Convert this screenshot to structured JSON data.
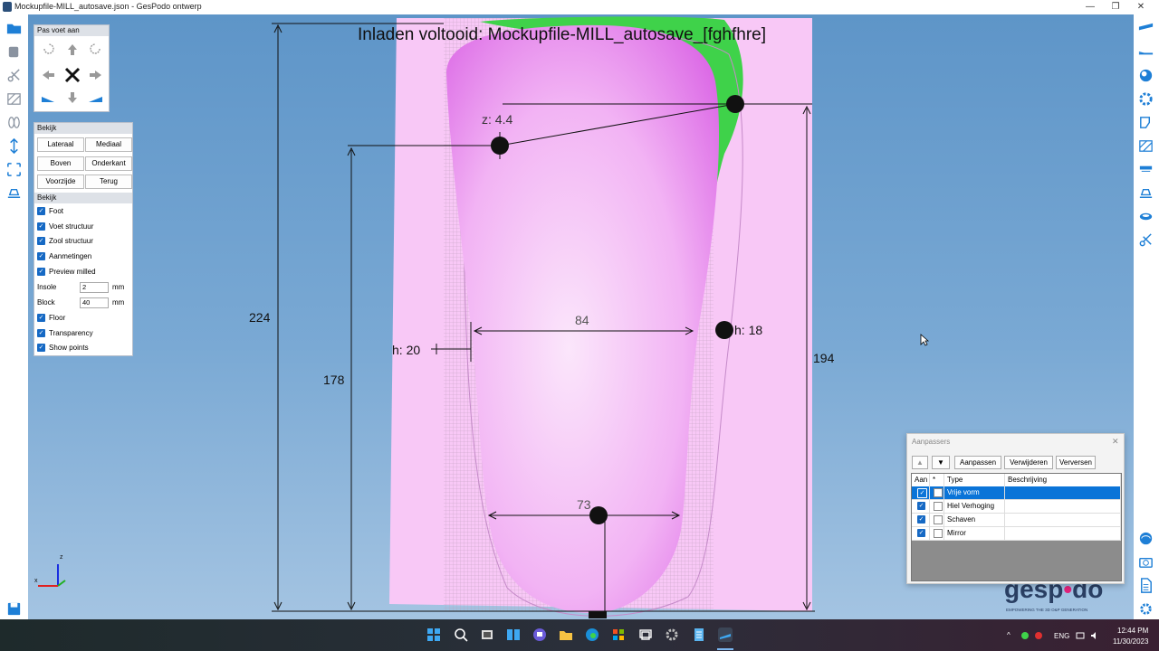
{
  "window": {
    "title": "Mockupfile-MILL_autosave.json - GesPodo ontwerp"
  },
  "pas_voet_aan": {
    "title": "Pas voet aan"
  },
  "bekijk_view": {
    "title": "Bekijk",
    "buttons": [
      "Lateraal",
      "Mediaal",
      "Boven",
      "Onderkant",
      "Voorzijde",
      "Terug"
    ]
  },
  "bekijk_options": {
    "title": "Bekijk",
    "checks_top": [
      "Foot",
      "Voet structuur",
      "Zool structuur",
      "Aanmetingen",
      "Preview milled"
    ],
    "insole_label": "Insole",
    "insole_value": "2",
    "insole_unit": "mm",
    "block_label": "Block",
    "block_value": "40",
    "block_unit": "mm",
    "checks_bottom": [
      "Floor",
      "Transparency",
      "Show points"
    ]
  },
  "viewport": {
    "status": "Inladen voltooid: Mockupfile-MILL_autosave_[fghfhre]",
    "measures": {
      "m224": "224",
      "m178": "178",
      "m194": "194",
      "m84": "84",
      "m73": "73",
      "z": "z: 4.4",
      "h20": "h: 20",
      "h18": "h: 18"
    },
    "axis": {
      "z": "z",
      "x": "x"
    },
    "logo": {
      "text": "gesp",
      "text2": "do",
      "tagline": "EMPOWERING THE 3D O&P GENERATION"
    }
  },
  "aanpassers": {
    "title": "Aanpassers",
    "buttons": {
      "aanpassen": "Aanpassen",
      "verwijderen": "Verwijderen",
      "verversen": "Verversen"
    },
    "columns": {
      "aan": "Aan",
      "star": "*",
      "type": "Type",
      "beschrijving": "Beschrijving"
    },
    "rows": [
      {
        "type": "Vrije vorm",
        "aan": true,
        "star": false,
        "selected": true
      },
      {
        "type": "Hiel Verhoging",
        "aan": true,
        "star": false,
        "selected": false
      },
      {
        "type": "Schaven",
        "aan": true,
        "star": false,
        "selected": false
      },
      {
        "type": "Mirror",
        "aan": true,
        "star": false,
        "selected": false
      }
    ]
  },
  "taskbar": {
    "lang": "ENG",
    "time": "12:44 PM",
    "date": "11/30/2023"
  },
  "colors": {
    "accent": "#1669c4",
    "selection": "#0a74d8",
    "viewport_top": "#5e95c8",
    "model_pink": "#f7c9f5",
    "model_magenta": "#e98ef0",
    "green": "#3fd24a"
  }
}
